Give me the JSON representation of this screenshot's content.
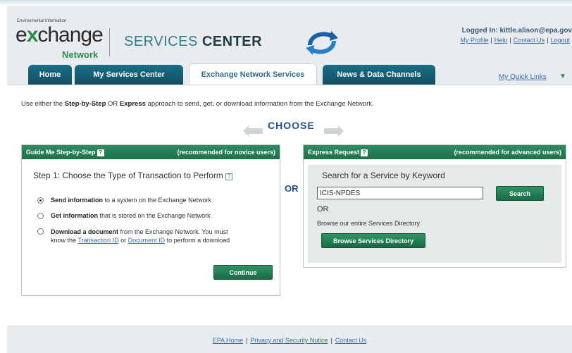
{
  "header": {
    "logo_small": "Environmental Information",
    "logo_main_prefix": "e",
    "logo_main_x": "x",
    "logo_main_suffix": "change",
    "logo_network": "Network",
    "title_light": "SERVICES",
    "title_bold": "CENTER",
    "logged_in": "Logged In: kittle.alison@epa.gov",
    "links": [
      "My Profile",
      "Help",
      "Contact Us",
      "Logout"
    ]
  },
  "tabs": [
    {
      "label": "Home",
      "active": false
    },
    {
      "label": "My Services Center",
      "active": false
    },
    {
      "label": "Exchange Network Services",
      "active": true
    },
    {
      "label": "News & Data Channels",
      "active": false
    }
  ],
  "quick_links": "My Quick Links",
  "intro": {
    "pre": "Use either the ",
    "step": "Step-by-Step",
    "mid": " OR ",
    "express": "Express",
    "post": " approach to send, get, or download information from the Exchange Network."
  },
  "choose": "CHOOSE",
  "or_label": "OR",
  "guide": {
    "header_left": "Guide Me Step-by-Step",
    "header_right": "(recommended for novice users)",
    "step_title": "Step 1: Choose the Type of Transaction to Perform",
    "options": [
      {
        "bold": "Send information",
        "text": " to a system on the Exchange Network",
        "selected": true
      },
      {
        "bold": "Get information",
        "text": " that is stored on the Exchange Network",
        "selected": false
      }
    ],
    "download": {
      "bold": "Download a document",
      "line1": " from the Exchange Network. You must",
      "line2_pre": "know the ",
      "link1": "Transaction ID",
      "mid": " or ",
      "link2": "Document ID",
      "line2_post": " to perform a download"
    },
    "continue_button": "Continue"
  },
  "express": {
    "header_left": "Express Request",
    "header_right": "(recommended for advanced users)",
    "keyword_title": "Search for a Service by Keyword",
    "keyword_value": "ICIS-NPDES",
    "search_button": "Search",
    "or_text": "OR",
    "browse_text": "Browse our entire Services Directory",
    "browse_button": "Browse Services Directory"
  },
  "footer": {
    "links": [
      "EPA Home",
      "Privacy and Security Notice",
      "Contact Us"
    ]
  },
  "colors": {
    "tab_blue": "#1a6e86",
    "panel_green": "#1f7049",
    "link_blue": "#3a6ab0",
    "choose_blue": "#1d4f8a"
  }
}
